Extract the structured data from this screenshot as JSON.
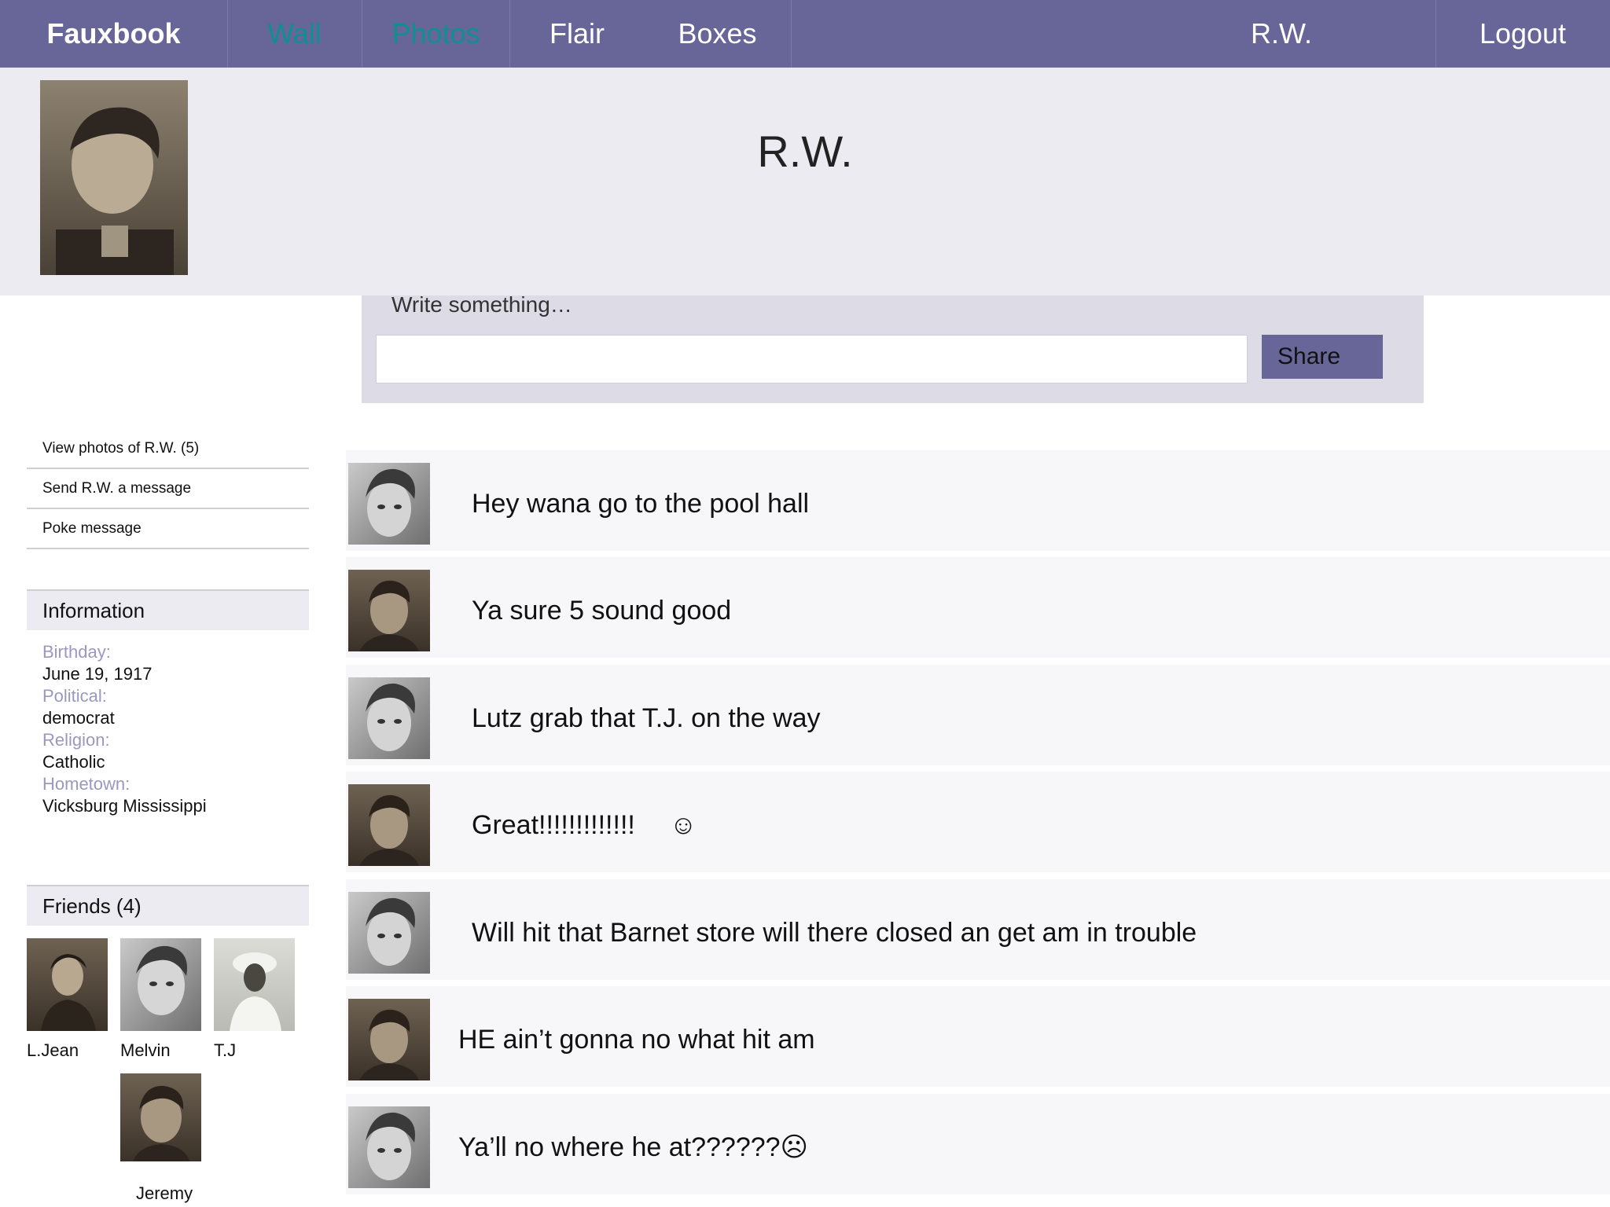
{
  "nav": {
    "brand": "Fauxbook",
    "items": [
      "Wall",
      "Photos",
      "Flair",
      "Boxes"
    ],
    "user": "R.W.",
    "logout": "Logout"
  },
  "profile": {
    "name": "R.W."
  },
  "composer": {
    "prompt": "Write something…",
    "input_value": "",
    "share_label": "Share"
  },
  "sidebar": {
    "links": [
      "View photos of R.W. (5)",
      "Send R.W. a message",
      "Poke message"
    ]
  },
  "information": {
    "title": "Information",
    "fields": [
      {
        "label": "Birthday:",
        "value": "June 19, 1917"
      },
      {
        "label": "Political:",
        "value": "democrat"
      },
      {
        "label": "Religion:",
        "value": "Catholic"
      },
      {
        "label": "Hometown:",
        "value": "Vicksburg Mississippi"
      }
    ]
  },
  "friends": {
    "title": "Friends (4)",
    "list": [
      "L.Jean",
      "Melvin",
      "T.J",
      "Jeremy"
    ]
  },
  "posts": [
    {
      "text": "Hey wana go to the pool hall",
      "emoji": ""
    },
    {
      "text": "Ya sure 5 sound good",
      "emoji": ""
    },
    {
      "text": "Lutz grab that T.J. on the way",
      "emoji": ""
    },
    {
      "text": "Great!!!!!!!!!!!!!",
      "emoji": "☺"
    },
    {
      "text": "Will hit that Barnet store will there closed an get am in trouble",
      "emoji": ""
    },
    {
      "text": "HE ain’t gonna no what hit am",
      "emoji": ""
    },
    {
      "text": "Ya’ll no where he at??????☹",
      "emoji": ""
    }
  ],
  "colors": {
    "nav": "#686699",
    "header": "#ecebf2",
    "composer": "#dcdbe6",
    "label": "#9a98c0",
    "active_nav": "#0f8f8f"
  }
}
